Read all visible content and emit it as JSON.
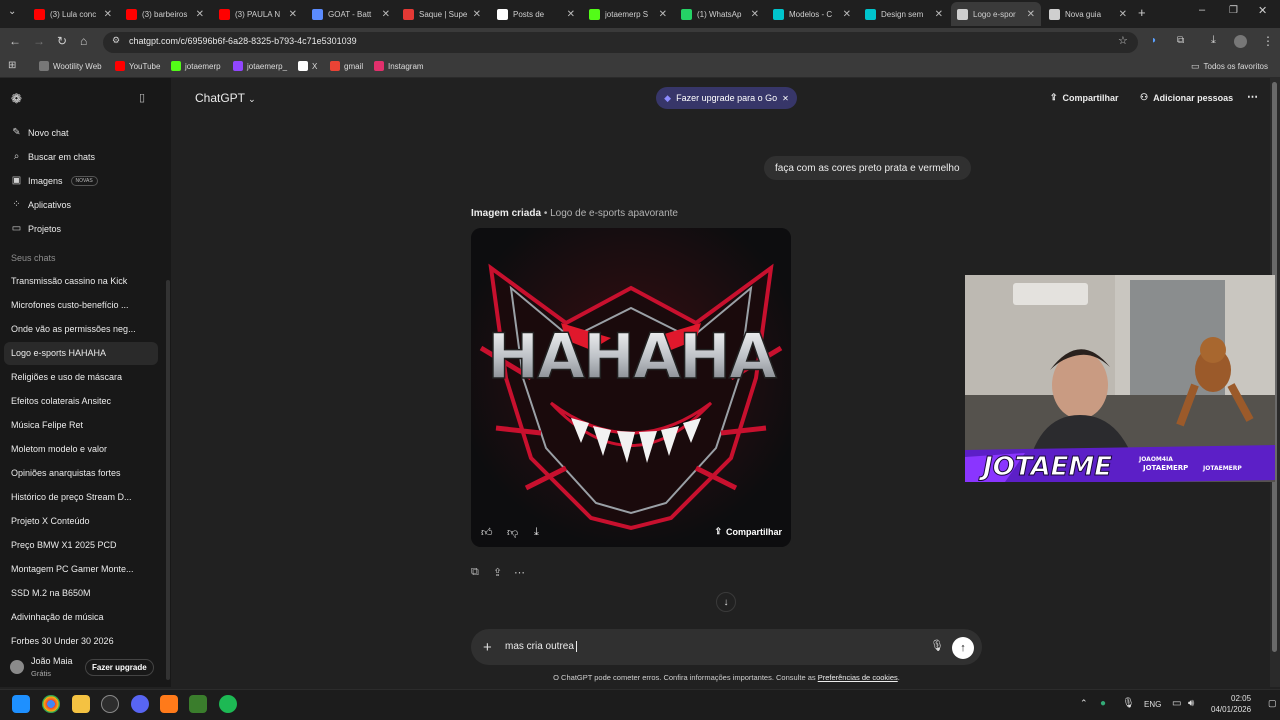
{
  "browser": {
    "tabs": [
      {
        "title": "(3) Lula conc",
        "icon_color": "#ff0000"
      },
      {
        "title": "(3) barbeiros",
        "icon_color": "#ff0000"
      },
      {
        "title": "(3) PAULA N",
        "icon_color": "#ff0000"
      },
      {
        "title": "GOAT - Batt",
        "icon_color": "#5b8cff"
      },
      {
        "title": "Saque | Supe",
        "icon_color": "#e53935"
      },
      {
        "title": "Posts de",
        "icon_color": "#ffffff"
      },
      {
        "title": "jotaemerp S",
        "icon_color": "#53fc18"
      },
      {
        "title": "(1) WhatsAp",
        "icon_color": "#25d366"
      },
      {
        "title": "Modelos - C",
        "icon_color": "#00c4cc"
      },
      {
        "title": "Design sem",
        "icon_color": "#00c4cc"
      },
      {
        "title": "Logo e-spor",
        "icon_color": "#cfcfcf"
      },
      {
        "title": "Nova guia",
        "icon_color": "#cfcfcf"
      }
    ],
    "url": "chatgpt.com/c/69596b6f-6a28-8325-b793-4c71e5301039",
    "bookmarks": [
      {
        "label": "Wootility Web",
        "icon_color": "#777777"
      },
      {
        "label": "YouTube",
        "icon_color": "#ff0000"
      },
      {
        "label": "jotaemerp",
        "icon_color": "#53fc18"
      },
      {
        "label": "jotaemerp_",
        "icon_color": "#9146ff"
      },
      {
        "label": "X",
        "icon_color": "#ffffff"
      },
      {
        "label": "gmail",
        "icon_color": "#ea4335"
      },
      {
        "label": "Instagram",
        "icon_color": "#e1306c"
      }
    ],
    "all_favorites": "Todos os favoritos"
  },
  "sidebar": {
    "nav": [
      {
        "label": "Novo chat",
        "icon": "new-chat-icon"
      },
      {
        "label": "Buscar em chats",
        "icon": "search-icon"
      },
      {
        "label": "Imagens",
        "icon": "images-icon",
        "badge": "NOVAS"
      },
      {
        "label": "Aplicativos",
        "icon": "apps-icon"
      },
      {
        "label": "Projetos",
        "icon": "folder-icon"
      }
    ],
    "section_title": "Seus chats",
    "chats": [
      "Transmissão cassino na Kick",
      "Microfones custo-benefício ...",
      "Onde vão as permissões neg...",
      "Logo e-sports HAHAHA",
      "Religiões e uso de máscara",
      "Efeitos colaterais Ansitec",
      "Música Felipe Ret",
      "Moletom modelo e valor",
      "Opiniões anarquistas fortes",
      "Histórico de preço Stream D...",
      "Projeto X Conteúdo",
      "Preço BMW X1 2025 PCD",
      "Montagem PC Gamer Monte...",
      "SSD M.2 na B650M",
      "Adivinhação de música",
      "Forbes 30 Under 30 2026"
    ],
    "active_chat_index": 3,
    "user": {
      "name": "João Maia",
      "plan": "Grátis",
      "upgrade_label": "Fazer upgrade"
    }
  },
  "header": {
    "model": "ChatGPT",
    "upgrade_pill": "Fazer upgrade para o Go",
    "share": "Compartilhar",
    "add_people": "Adicionar pessoas"
  },
  "conversation": {
    "user_message": "faça com as cores preto prata e vermelho",
    "image_caption_bold": "Imagem criada",
    "image_caption_rest": " • Logo de e-sports apavorante",
    "image_text": "HAHAHA",
    "image_share": "Compartilhar"
  },
  "composer": {
    "value": "mas cria outrea",
    "disclaimer_text": "O ChatGPT pode cometer erros. Confira informações importantes. Consulte as ",
    "disclaimer_link": "Preferências de cookies",
    "disclaimer_end": "."
  },
  "webcam": {
    "banner_name": "JOTAEME",
    "handle_1": "JOAOM4IA",
    "handle_2": "JOTAEMERP",
    "handle_3": "JOTAEMERP",
    "accent": "#6a1fd6"
  },
  "taskbar": {
    "language": "ENG",
    "time": "02:05",
    "date": "04/01/2026"
  }
}
